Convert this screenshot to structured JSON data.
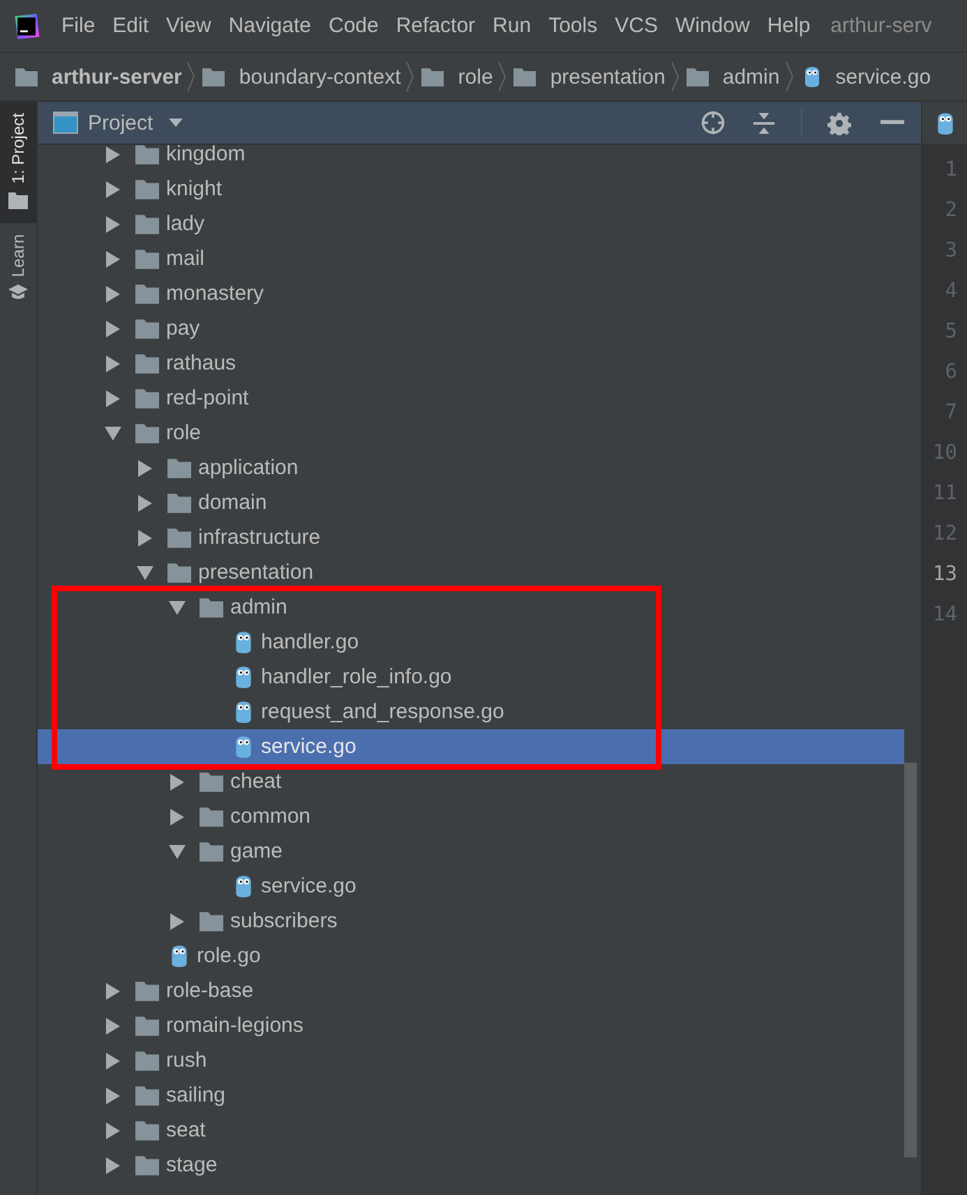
{
  "menu_bar": {
    "items": [
      "File",
      "Edit",
      "View",
      "Navigate",
      "Code",
      "Refactor",
      "Run",
      "Tools",
      "VCS",
      "Window",
      "Help"
    ],
    "window_title": "arthur-serv"
  },
  "breadcrumbs": [
    {
      "label": "arthur-server",
      "kind": "folder"
    },
    {
      "label": "boundary-context",
      "kind": "folder"
    },
    {
      "label": "role",
      "kind": "folder"
    },
    {
      "label": "presentation",
      "kind": "folder"
    },
    {
      "label": "admin",
      "kind": "folder"
    },
    {
      "label": "service.go",
      "kind": "go-file"
    }
  ],
  "side_tabs": [
    {
      "label": "1: Project",
      "selected": true
    },
    {
      "label": "Learn",
      "selected": false
    }
  ],
  "project_panel": {
    "title": "Project",
    "tree": [
      {
        "label": "kingdom",
        "kind": "folder",
        "expanded": false,
        "selected": false,
        "boxed": false
      },
      {
        "label": "knight",
        "kind": "folder",
        "expanded": false,
        "selected": false,
        "boxed": false
      },
      {
        "label": "lady",
        "kind": "folder",
        "expanded": false,
        "selected": false,
        "boxed": false
      },
      {
        "label": "mail",
        "kind": "folder",
        "expanded": false,
        "selected": false,
        "boxed": false
      },
      {
        "label": "monastery",
        "kind": "folder",
        "expanded": false,
        "selected": false,
        "boxed": false
      },
      {
        "label": "pay",
        "kind": "folder",
        "expanded": false,
        "selected": false,
        "boxed": false
      },
      {
        "label": "rathaus",
        "kind": "folder",
        "expanded": false,
        "selected": false,
        "boxed": false
      },
      {
        "label": "red-point",
        "kind": "folder",
        "expanded": false,
        "selected": false,
        "boxed": false
      },
      {
        "label": "role",
        "kind": "folder",
        "expanded": true,
        "selected": false,
        "boxed": false,
        "children": [
          {
            "label": "application",
            "kind": "folder",
            "expanded": false,
            "selected": false,
            "boxed": false
          },
          {
            "label": "domain",
            "kind": "folder",
            "expanded": false,
            "selected": false,
            "boxed": false
          },
          {
            "label": "infrastructure",
            "kind": "folder",
            "expanded": false,
            "selected": false,
            "boxed": false
          },
          {
            "label": "presentation",
            "kind": "folder",
            "expanded": true,
            "selected": false,
            "boxed": false,
            "children": [
              {
                "label": "admin",
                "kind": "folder",
                "expanded": true,
                "selected": false,
                "boxed": true,
                "children": [
                  {
                    "label": "handler.go",
                    "kind": "go-file",
                    "selected": false,
                    "boxed": false
                  },
                  {
                    "label": "handler_role_info.go",
                    "kind": "go-file",
                    "selected": false,
                    "boxed": false
                  },
                  {
                    "label": "request_and_response.go",
                    "kind": "go-file",
                    "selected": false,
                    "boxed": false
                  },
                  {
                    "label": "service.go",
                    "kind": "go-file",
                    "selected": true,
                    "boxed": false
                  }
                ]
              },
              {
                "label": "cheat",
                "kind": "folder",
                "expanded": false,
                "selected": false,
                "boxed": false
              },
              {
                "label": "common",
                "kind": "folder",
                "expanded": false,
                "selected": false,
                "boxed": false
              },
              {
                "label": "game",
                "kind": "folder",
                "expanded": true,
                "selected": false,
                "boxed": false,
                "children": [
                  {
                    "label": "service.go",
                    "kind": "go-file",
                    "selected": false,
                    "boxed": false
                  }
                ]
              },
              {
                "label": "subscribers",
                "kind": "folder",
                "expanded": false,
                "selected": false,
                "boxed": false
              }
            ]
          },
          {
            "label": "role.go",
            "kind": "go-file",
            "selected": false,
            "boxed": false
          }
        ]
      },
      {
        "label": "role-base",
        "kind": "folder",
        "expanded": false,
        "selected": false,
        "boxed": false
      },
      {
        "label": "romain-legions",
        "kind": "folder",
        "expanded": false,
        "selected": false,
        "boxed": false
      },
      {
        "label": "rush",
        "kind": "folder",
        "expanded": false,
        "selected": false,
        "boxed": false
      },
      {
        "label": "sailing",
        "kind": "folder",
        "expanded": false,
        "selected": false,
        "boxed": false
      },
      {
        "label": "seat",
        "kind": "folder",
        "expanded": false,
        "selected": false,
        "boxed": false
      },
      {
        "label": "stage",
        "kind": "folder",
        "expanded": false,
        "selected": false,
        "boxed": false
      }
    ]
  },
  "editor": {
    "line_numbers": [
      {
        "text": "1",
        "current": false
      },
      {
        "text": "2",
        "current": false
      },
      {
        "text": "3",
        "current": false
      },
      {
        "text": "4",
        "current": false
      },
      {
        "text": "5",
        "current": false
      },
      {
        "text": "6",
        "current": false
      },
      {
        "text": "7",
        "current": false
      },
      {
        "text": "10",
        "current": false
      },
      {
        "text": "11",
        "current": false
      },
      {
        "text": "12",
        "current": false
      },
      {
        "text": "13",
        "current": true
      },
      {
        "text": "14",
        "current": false
      }
    ]
  }
}
